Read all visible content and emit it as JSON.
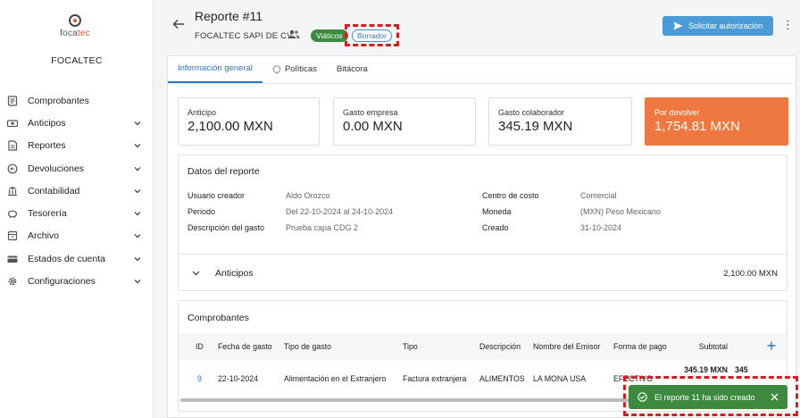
{
  "sidebar": {
    "logo_prefix": "foca",
    "logo_suffix": "tec",
    "company": "FOCALTEC",
    "items": [
      {
        "label": "Comprobantes",
        "icon": "receipt-icon",
        "chevron": false
      },
      {
        "label": "Anticipos",
        "icon": "cash-icon",
        "chevron": true
      },
      {
        "label": "Reportes",
        "icon": "report-icon",
        "chevron": true
      },
      {
        "label": "Devoluciones",
        "icon": "refund-icon",
        "chevron": true
      },
      {
        "label": "Contabilidad",
        "icon": "bank-icon",
        "chevron": true
      },
      {
        "label": "Tesorería",
        "icon": "piggy-icon",
        "chevron": true
      },
      {
        "label": "Archivo",
        "icon": "archive-icon",
        "chevron": true
      },
      {
        "label": "Estados de cuenta",
        "icon": "card-icon",
        "chevron": true
      },
      {
        "label": "Configuraciones",
        "icon": "gear-icon",
        "chevron": true
      }
    ]
  },
  "header": {
    "title": "Reporte #11",
    "subtitle": "FOCALTEC SAPI DE CV",
    "badge_type": "Viáticos",
    "badge_status": "Borrador",
    "primary_button": "Solicitar autorización"
  },
  "tabs": [
    {
      "label": "Información general",
      "active": true
    },
    {
      "label": "Políticas",
      "active": false
    },
    {
      "label": "Bitácora",
      "active": false
    }
  ],
  "summary": [
    {
      "label": "Anticipo",
      "value": "2,100.00 MXN"
    },
    {
      "label": "Gasto empresa",
      "value": "0.00 MXN"
    },
    {
      "label": "Gasto colaborador",
      "value": "345.19 MXN"
    },
    {
      "label": "Por devolver",
      "value": "1,754.81 MXN"
    }
  ],
  "details": {
    "title": "Datos del reporte",
    "left": [
      {
        "key": "Usuario creador",
        "value": "Aldo Orozco"
      },
      {
        "key": "Periodo",
        "value": "Del 22-10-2024 al 24-10-2024"
      },
      {
        "key": "Descripción del gasto",
        "value": "Prueba capa CDG 2"
      }
    ],
    "right": [
      {
        "key": "Centro de costo",
        "value": "Comercial"
      },
      {
        "key": "Moneda",
        "value": "(MXN) Peso Mexicano"
      },
      {
        "key": "Creado",
        "value": "31-10-2024"
      }
    ]
  },
  "anticipos": {
    "title": "Anticipos",
    "amount": "2,100.00 MXN"
  },
  "comprobantes": {
    "title": "Comprobantes",
    "columns": [
      "ID",
      "Fecha de gasto",
      "Tipo de gasto",
      "Tipo",
      "Descripción",
      "Nombre del Emisor",
      "Forma de pago",
      "Subtotal"
    ],
    "rows": [
      {
        "id": "9",
        "fecha": "22-10-2024",
        "tipo_gasto": "Alimentación en el Extranjero",
        "tipo": "Factura extranjera",
        "descripcion": "ALIMENTOS",
        "emisor": "LA MONA USA",
        "forma_pago": "EFECTIVO",
        "subtotal": "345.19 MXN",
        "subtotal_extra": "345"
      }
    ]
  },
  "toast": {
    "message": "El reporte 11 ha sido creado"
  }
}
